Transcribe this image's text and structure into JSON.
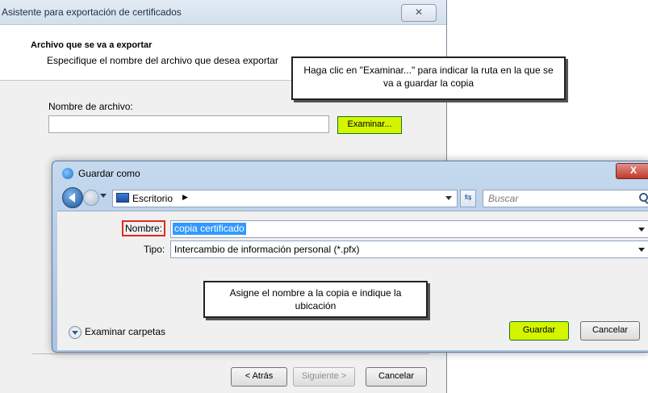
{
  "wizard": {
    "title": "Asistente para exportación de certificados",
    "header_title": "Archivo que se va a exportar",
    "header_subtitle": "Especifique el nombre del archivo que desea exportar",
    "filename_label": "Nombre de archivo:",
    "filename_value": "",
    "browse_label": "Examinar...",
    "back_label": "< Atrás",
    "next_label": "Siguiente >",
    "cancel_label": "Cancelar",
    "highlight_color": "#d4f500"
  },
  "callouts": {
    "browse_hint": "Haga clic en \"Examinar...\" para indicar la ruta en la que se va a guardar la copia",
    "name_hint": "Asigne el nombre a la copia e indique la ubicación"
  },
  "save_dialog": {
    "title": "Guardar como",
    "title_icon": "internet-explorer-icon",
    "location": "Escritorio",
    "search_placeholder": "Buscar",
    "name_label": "Nombre:",
    "name_value": "copia certificado",
    "type_label": "Tipo:",
    "type_value": "Intercambio de información personal (*.pfx)",
    "browse_folders_label": "Examinar carpetas",
    "save_label": "Guardar",
    "cancel_label": "Cancelar",
    "close_label": "X",
    "name_label_border_color": "#e3281c"
  }
}
